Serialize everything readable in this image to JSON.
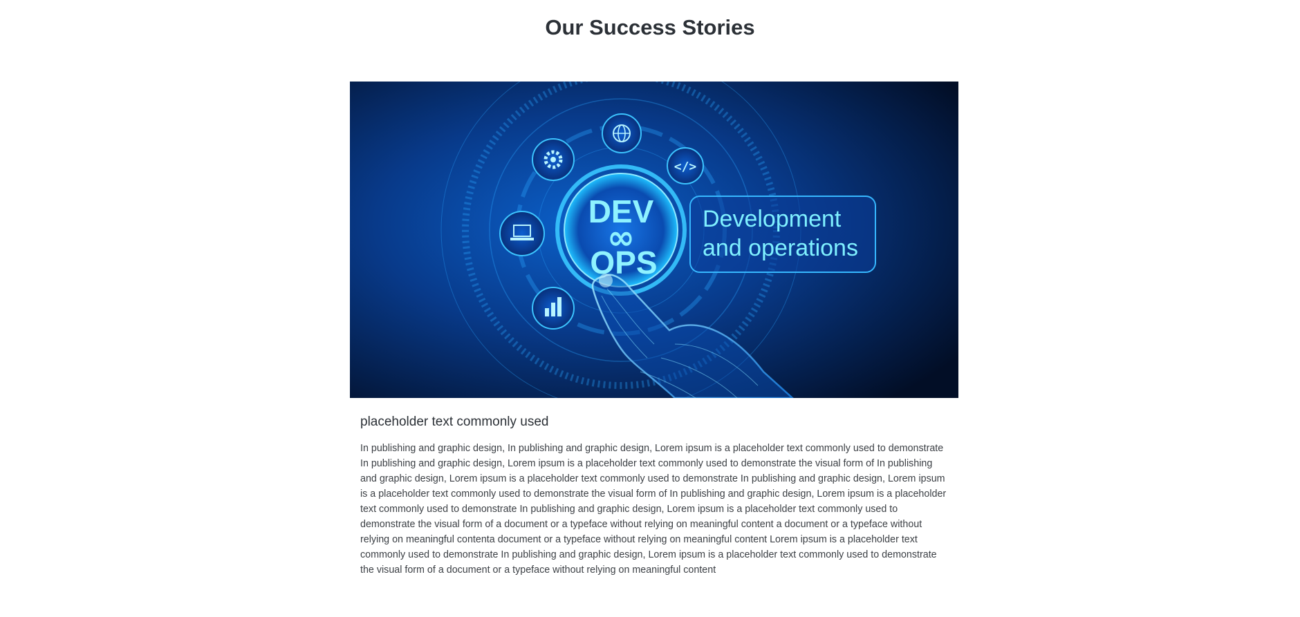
{
  "section": {
    "title": "Our Success Stories"
  },
  "story": {
    "image": {
      "badge_line1": "DEV",
      "badge_symbol": "∞",
      "badge_line2": "OPS",
      "caption_line1": "Development",
      "caption_line2": "and operations",
      "icons": [
        "globe-icon",
        "gear-icon",
        "code-icon",
        "laptop-icon",
        "bar-chart-icon"
      ],
      "colors": {
        "bg_dark": "#02122e",
        "bg_mid": "#0a3d8f",
        "glow": "#1fa8ff",
        "text": "#7ff0ff"
      }
    },
    "heading": "placeholder text commonly used",
    "paragraph": "In publishing and graphic design, In publishing and graphic design, Lorem ipsum is a placeholder text commonly used to demonstrate In publishing and graphic design, Lorem ipsum is a placeholder text commonly used to demonstrate the visual form of In publishing and graphic design, Lorem ipsum is a placeholder text commonly used to demonstrate In publishing and graphic design, Lorem ipsum is a placeholder text commonly used to demonstrate the visual form of In publishing and graphic design, Lorem ipsum is a placeholder text commonly used to demonstrate In publishing and graphic design, Lorem ipsum is a placeholder text commonly used to demonstrate the visual form of a document or a typeface without relying on meaningful content a document or a typeface without relying on meaningful contenta document or a typeface without relying on meaningful content Lorem ipsum is a placeholder text commonly used to demonstrate In publishing and graphic design, Lorem ipsum is a placeholder text commonly used to demonstrate the visual form of a document or a typeface without relying on meaningful content"
  }
}
